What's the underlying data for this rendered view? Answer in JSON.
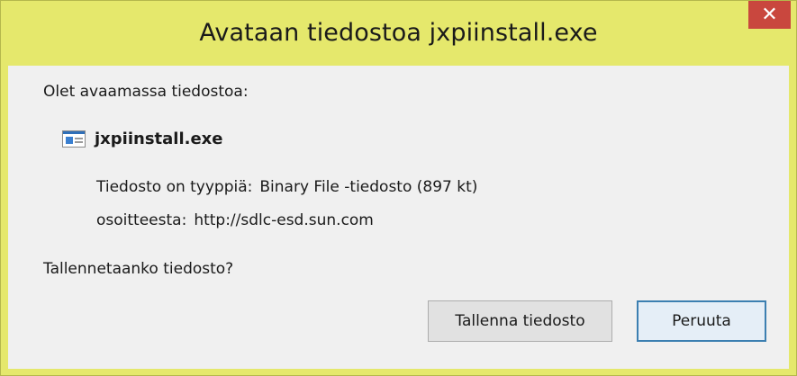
{
  "window": {
    "title": "Avataan tiedostoa jxpiinstall.exe",
    "close_glyph": "✕",
    "accent_color": "#e5e86c",
    "close_color": "#c9473e"
  },
  "dialog": {
    "intro": "Olet avaamassa tiedostoa:",
    "file_icon": "exe-file-icon",
    "filename": "jxpiinstall.exe",
    "type_label": "Tiedosto on tyyppiä:",
    "type_value": "Binary File -tiedosto (897 kt)",
    "from_label": "osoitteesta:",
    "from_value": "http://sdlc-esd.sun.com",
    "question": "Tallennetaanko tiedosto?"
  },
  "buttons": {
    "save_label": "Tallenna tiedosto",
    "cancel_label": "Peruuta"
  }
}
